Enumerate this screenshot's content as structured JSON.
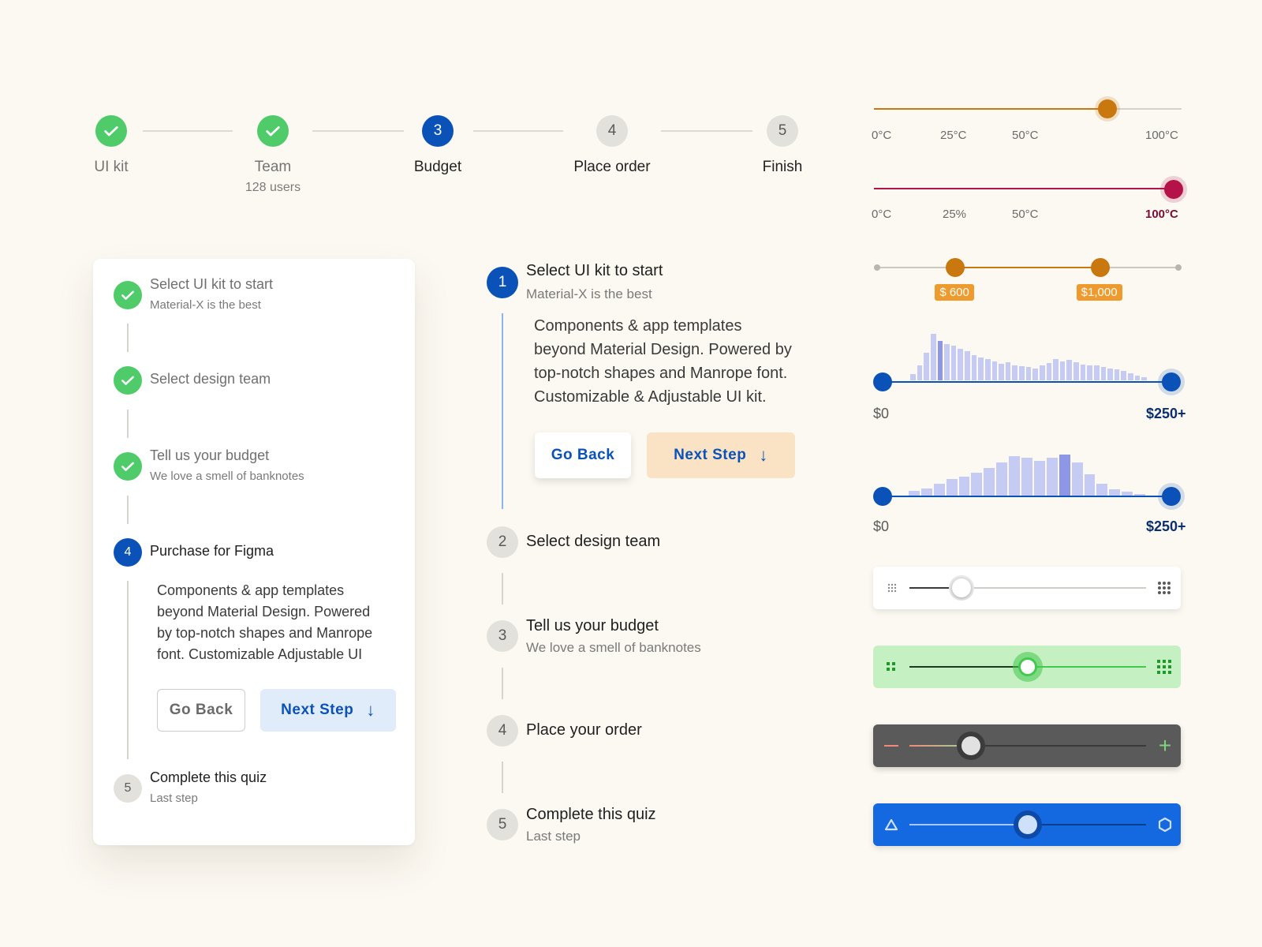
{
  "horizontal_stepper": {
    "steps": [
      {
        "number": "1",
        "label": "UI kit",
        "sub": "",
        "state": "done"
      },
      {
        "number": "2",
        "label": "Team",
        "sub": "128 users",
        "state": "done"
      },
      {
        "number": "3",
        "label": "Budget",
        "sub": "",
        "state": "active"
      },
      {
        "number": "4",
        "label": "Place order",
        "sub": "",
        "state": "pending"
      },
      {
        "number": "5",
        "label": "Finish",
        "sub": "",
        "state": "pending"
      }
    ]
  },
  "card_stepper": {
    "steps": [
      {
        "number": "1",
        "title": "Select UI kit to start",
        "sub": "Material-X is the best",
        "state": "done"
      },
      {
        "number": "2",
        "title": "Select design team",
        "sub": "",
        "state": "done"
      },
      {
        "number": "3",
        "title": "Tell us your budget",
        "sub": "We love a smell of banknotes",
        "state": "done"
      },
      {
        "number": "4",
        "title": "Purchase for Figma",
        "sub": "",
        "state": "active"
      },
      {
        "number": "5",
        "title": "Complete this quiz",
        "sub": "Last step",
        "state": "pending"
      }
    ],
    "body_lines": [
      "Components & app templates",
      "beyond Material Design. Powered",
      "by top-notch shapes and Manrope",
      "font. Customizable Adjustable UI"
    ],
    "back_label": "Go Back",
    "next_label": "Next Step"
  },
  "middle_stepper": {
    "steps": [
      {
        "number": "1",
        "title": "Select UI kit to start",
        "sub": "Material-X is the best",
        "state": "active"
      },
      {
        "number": "2",
        "title": "Select design team",
        "sub": "",
        "state": "pending"
      },
      {
        "number": "3",
        "title": "Tell us your budget",
        "sub": "We love a smell of banknotes",
        "state": "pending"
      },
      {
        "number": "4",
        "title": "Place your order",
        "sub": "",
        "state": "pending"
      },
      {
        "number": "5",
        "title": "Complete this quiz",
        "sub": "Last step",
        "state": "pending"
      }
    ],
    "body_lines": [
      "Components & app templates",
      "beyond Material Design. Powered by",
      "top-notch shapes and Manrope font.",
      "Customizable & Adjustable UI kit."
    ],
    "back_label": "Go Back",
    "next_label": "Next Step"
  },
  "sliders": {
    "temp1": {
      "ticks": [
        "0°C",
        "25°C",
        "50°C",
        "100°C"
      ],
      "value": 0.76,
      "color": "#c9770f"
    },
    "temp2": {
      "ticks": [
        "0°C",
        "25%",
        "50°C",
        "100°C"
      ],
      "value": 1.0,
      "color": "#b5124a"
    },
    "range": {
      "low_label": "$ 600",
      "high_label": "$1,000",
      "low": 0.26,
      "high": 0.74,
      "color": "#c9770f"
    },
    "histogram1": {
      "min_label": "$0",
      "max_label": "$250+",
      "bars": [
        0.12,
        0.3,
        0.55,
        0.92,
        0.78,
        0.72,
        0.68,
        0.62,
        0.58,
        0.5,
        0.45,
        0.42,
        0.38,
        0.33,
        0.36,
        0.3,
        0.28,
        0.26,
        0.24,
        0.3,
        0.35,
        0.42,
        0.38,
        0.4,
        0.36,
        0.32,
        0.3,
        0.3,
        0.26,
        0.24,
        0.22,
        0.18,
        0.14,
        0.1,
        0.06
      ],
      "highlight": 4
    },
    "histogram2": {
      "min_label": "$0",
      "max_label": "$250+",
      "bars": [
        0.1,
        0.16,
        0.26,
        0.36,
        0.42,
        0.5,
        0.6,
        0.72,
        0.86,
        0.82,
        0.76,
        0.82,
        0.9,
        0.72,
        0.46,
        0.26,
        0.14,
        0.08,
        0.04
      ],
      "highlight": 12
    },
    "discrete_light": {
      "value": 0.22
    },
    "discrete_green": {
      "value": 0.5,
      "color": "#43c94f"
    },
    "discrete_dark": {
      "value": 0.26
    },
    "discrete_blue": {
      "value": 0.5,
      "color": "#1468e0"
    }
  },
  "icons": {
    "check": "check-icon",
    "arrow_down": "arrow-down-icon",
    "grid_small": "grid-small-icon",
    "grid_large": "grid-large-icon",
    "minus": "minus-icon",
    "plus": "plus-icon",
    "triangle": "triangle-icon",
    "hexagon": "hexagon-icon"
  }
}
